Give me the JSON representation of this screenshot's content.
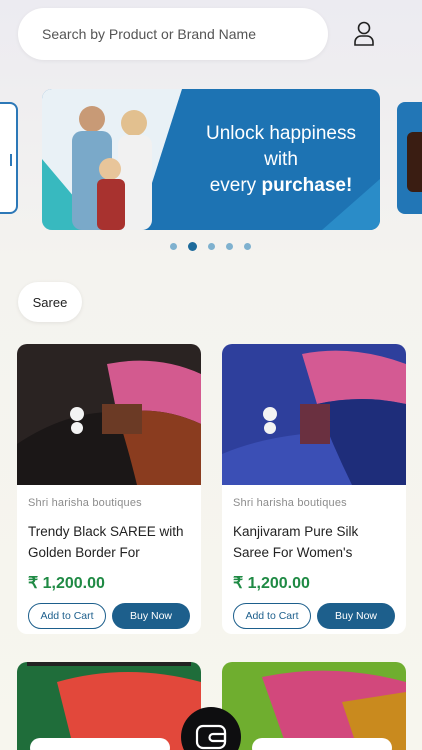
{
  "search": {
    "placeholder": "Search by Product or Brand Name"
  },
  "header": {
    "user_icon": "user-icon"
  },
  "banner": {
    "line1": "Unlock happiness",
    "line2": "with",
    "line3_prefix": "every ",
    "line3_bold": "purchase!",
    "dots_count": 5,
    "active_dot": 1,
    "bg_color": "#1d73b3"
  },
  "category_chip": {
    "label": "Saree"
  },
  "products": [
    {
      "brand": "Shri harisha boutiques",
      "title": "Trendy Black SAREE with Golden Border For Wome…",
      "price": "₹ 1,200.00",
      "add_to_cart": "Add to Cart",
      "buy_now": "Buy Now"
    },
    {
      "brand": "Shri harisha boutiques",
      "title": "Kanjivaram Pure Silk Saree For Women's",
      "price": "₹ 1,200.00",
      "add_to_cart": "Add to Cart",
      "buy_now": "Buy Now"
    }
  ],
  "colors": {
    "price": "#1f8a44",
    "primary": "#1d5f8c"
  }
}
